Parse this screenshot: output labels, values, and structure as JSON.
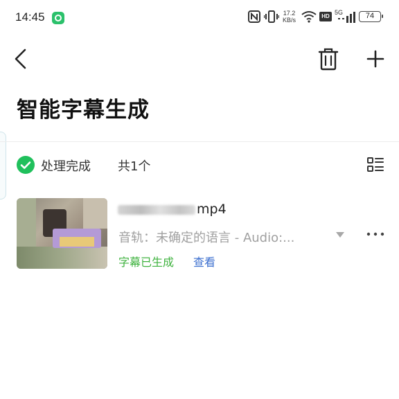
{
  "status_bar": {
    "time": "14:45",
    "net_speed_value": "17.2",
    "net_speed_unit": "KB/s",
    "hd_label": "HD",
    "network_type": "5G",
    "battery_level": "74"
  },
  "header": {
    "title": "智能字幕生成"
  },
  "status_row": {
    "status_label": "处理完成",
    "count_label": "共1个"
  },
  "file_item": {
    "file_name_suffix": "mp4",
    "track_label": "音轨：未确定的语言 - Audio:...",
    "subtitle_status": "字幕已生成",
    "view_link": "查看"
  },
  "colors": {
    "success_green": "#20c05c",
    "subtitle_status_green": "#3eb23e",
    "link_blue": "#3c6fcf"
  }
}
